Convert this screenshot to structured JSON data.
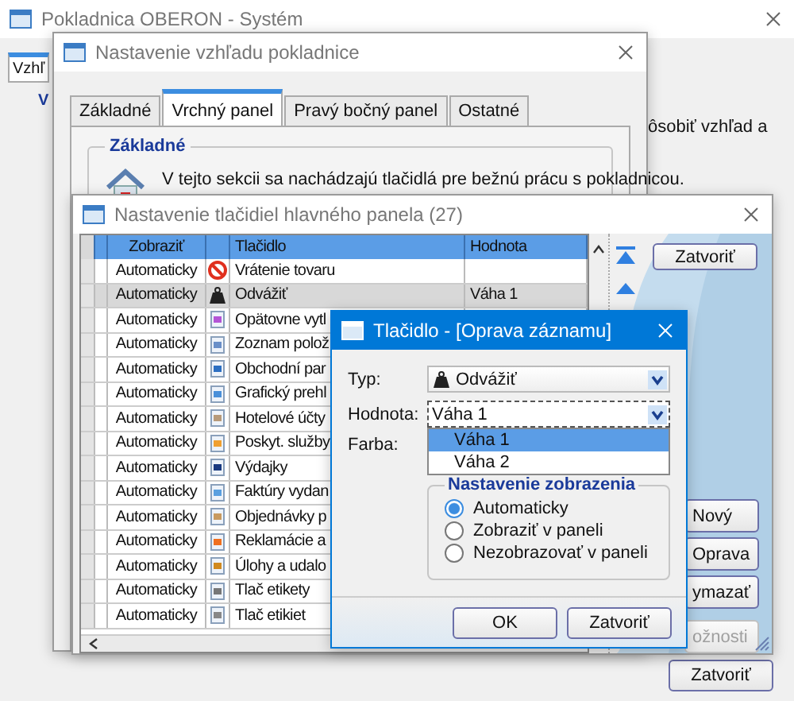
{
  "main_window": {
    "title": "Pokladnica OBERON - Systém",
    "tab_label": "Vzhľ",
    "group_label": "V",
    "text_fragment": "ôsobiť vzhľad a",
    "close_button": "Zatvoriť"
  },
  "appearance_window": {
    "title": "Nastavenie vzhľadu pokladnice",
    "tabs": [
      {
        "label": "Základné",
        "selected": false
      },
      {
        "label": "Vrchný panel",
        "selected": true
      },
      {
        "label": "Pravý bočný panel",
        "selected": false
      },
      {
        "label": "Ostatné",
        "selected": false
      }
    ],
    "group_title": "Základné",
    "description": "V tejto sekcii sa nachádzajú tlačidlá pre bežnú prácu s pokladnicou."
  },
  "buttons_window": {
    "title": "Nastavenie tlačidiel hlavného panela (27)",
    "columns": [
      "Zobraziť",
      "Tlačidlo",
      "Hodnota"
    ],
    "rows": [
      {
        "display": "Automaticky",
        "button": "Vrátenie tovaru",
        "selected": false
      },
      {
        "display": "Automaticky",
        "button": "Odvážiť",
        "value": "Váha 1",
        "selected": true
      },
      {
        "display": "Automaticky",
        "button": "Opätovne vytl",
        "selected": false
      },
      {
        "display": "Automaticky",
        "button": "Zoznam polož",
        "selected": false
      },
      {
        "display": "Automaticky",
        "button": "Obchodní par",
        "selected": false
      },
      {
        "display": "Automaticky",
        "button": "Grafický prehl",
        "selected": false
      },
      {
        "display": "Automaticky",
        "button": "Hotelové účty",
        "selected": false
      },
      {
        "display": "Automaticky",
        "button": "Poskyt. služby",
        "selected": false
      },
      {
        "display": "Automaticky",
        "button": "Výdajky",
        "selected": false
      },
      {
        "display": "Automaticky",
        "button": "Faktúry vydan",
        "selected": false
      },
      {
        "display": "Automaticky",
        "button": "Objednávky p",
        "selected": false
      },
      {
        "display": "Automaticky",
        "button": "Reklamácie a",
        "selected": false
      },
      {
        "display": "Automaticky",
        "button": "Úlohy a udalo",
        "selected": false
      },
      {
        "display": "Automaticky",
        "button": "Tlač etikety",
        "selected": false
      },
      {
        "display": "Automaticky",
        "button": "Tlač etikiet",
        "selected": false
      }
    ],
    "close_button": "Zatvoriť",
    "side_buttons": [
      {
        "label": "Nový",
        "disabled": false
      },
      {
        "label": "Oprava",
        "disabled": false
      },
      {
        "label": "ymazať",
        "disabled": false
      },
      {
        "label": "ožnosti",
        "disabled": true
      }
    ]
  },
  "edit_dialog": {
    "title": "Tlačidlo - [Oprava záznamu]",
    "type_label": "Typ:",
    "type_value": "Odvážiť",
    "value_label": "Hodnota:",
    "value_value": "Váha 1",
    "options": [
      {
        "label": "Váha 1",
        "selected": true
      },
      {
        "label": "Váha 2",
        "selected": false
      }
    ],
    "color_label": "Farba:",
    "group_title": "Nastavenie zobrazenia",
    "radios": [
      {
        "label": "Automaticky",
        "selected": true
      },
      {
        "label": "Zobraziť v paneli",
        "selected": false
      },
      {
        "label": "Nezobrazovať v paneli",
        "selected": false
      }
    ],
    "buttons": [
      "OK",
      "Zatvoriť"
    ]
  }
}
